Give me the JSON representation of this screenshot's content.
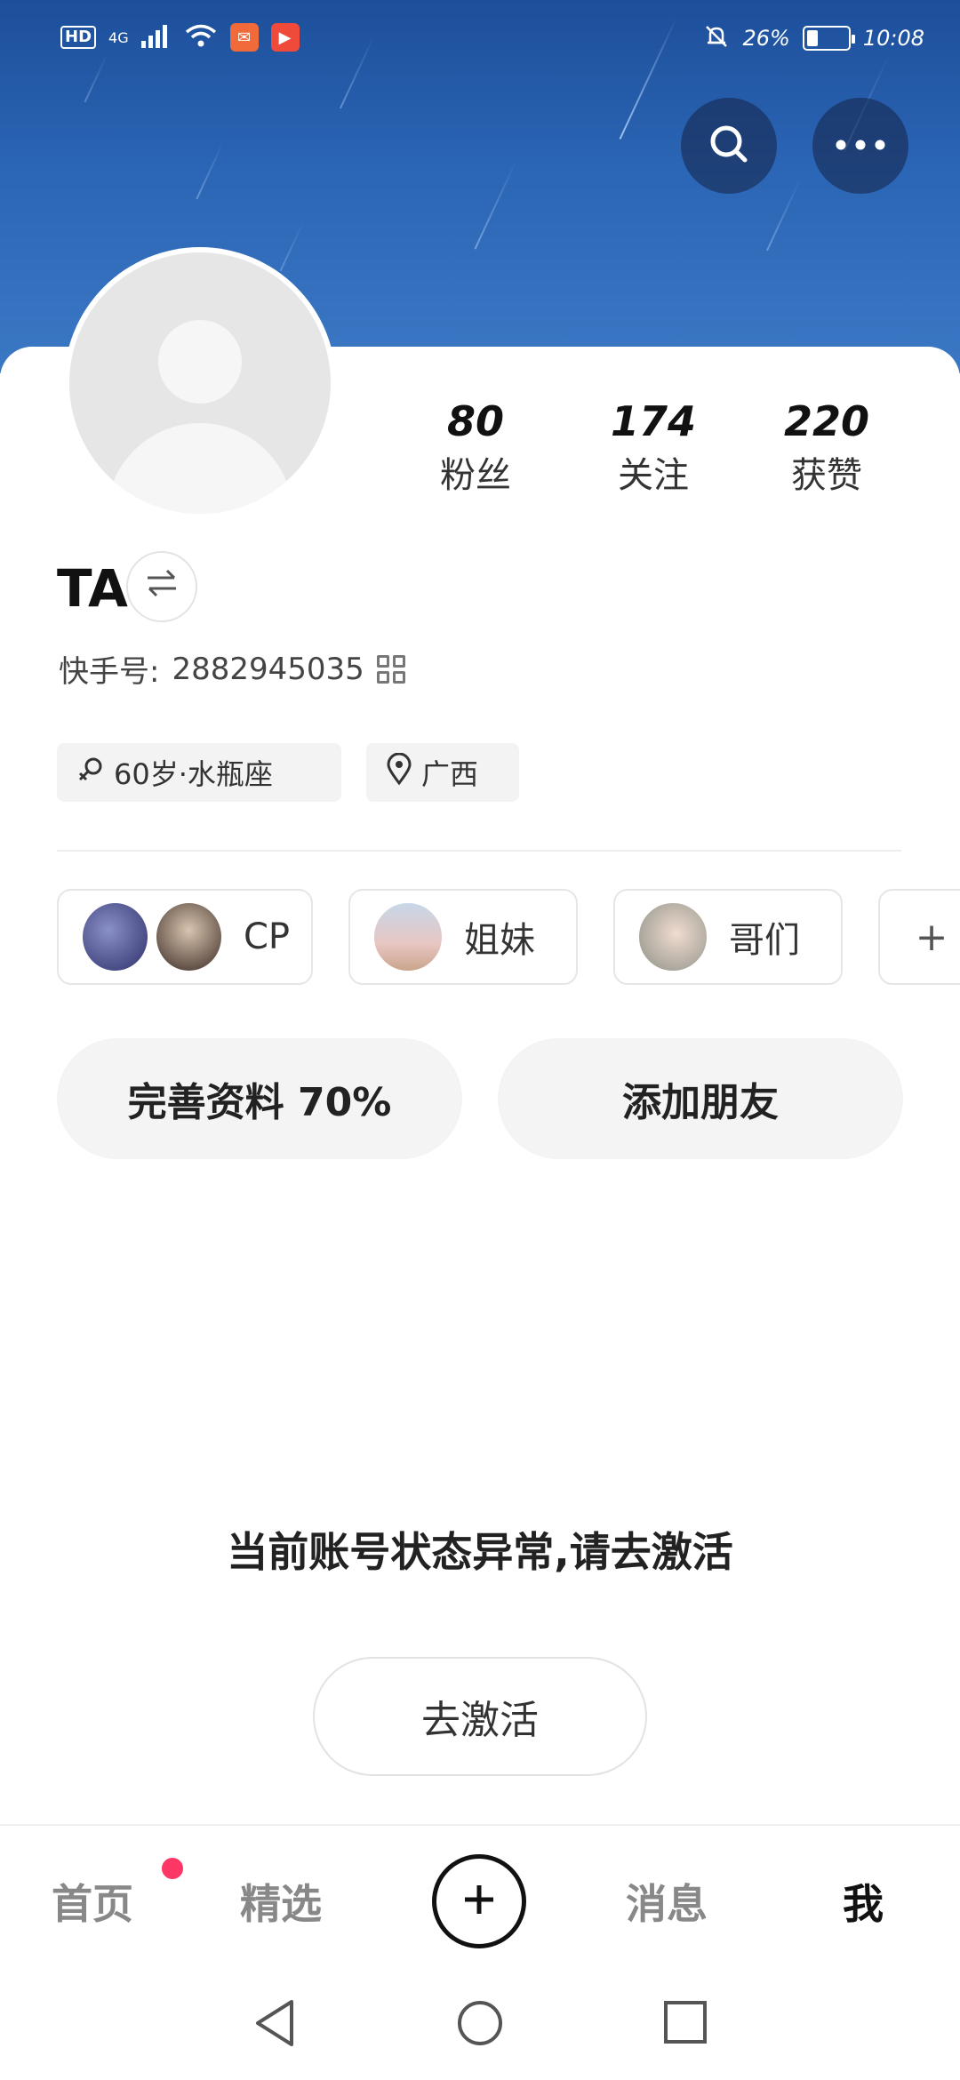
{
  "status_bar": {
    "network": "HD",
    "signal_type": "4G",
    "battery_percent": "26%",
    "time": "10:08"
  },
  "profile": {
    "name": "TA",
    "kuaishou_id_label": "快手号:",
    "kuaishou_id": "2882945035",
    "stats": [
      {
        "value": "80",
        "label": "粉丝"
      },
      {
        "value": "174",
        "label": "关注"
      },
      {
        "value": "220",
        "label": "获赞"
      }
    ],
    "tags": {
      "age_constellation": "60岁·水瓶座",
      "location": "广西"
    }
  },
  "groups": [
    {
      "label": "CP"
    },
    {
      "label": "姐妹"
    },
    {
      "label": "哥们"
    },
    {
      "label": "+"
    }
  ],
  "actions": {
    "complete_profile": "完善资料 70%",
    "add_friends": "添加朋友"
  },
  "notice": {
    "text": "当前账号状态异常,请去激活",
    "button": "去激活"
  },
  "bottom_nav": {
    "home": "首页",
    "featured": "精选",
    "messages": "消息",
    "me": "我"
  },
  "colors": {
    "accent_red": "#fe3666",
    "header_blue": "#2b65b5"
  }
}
